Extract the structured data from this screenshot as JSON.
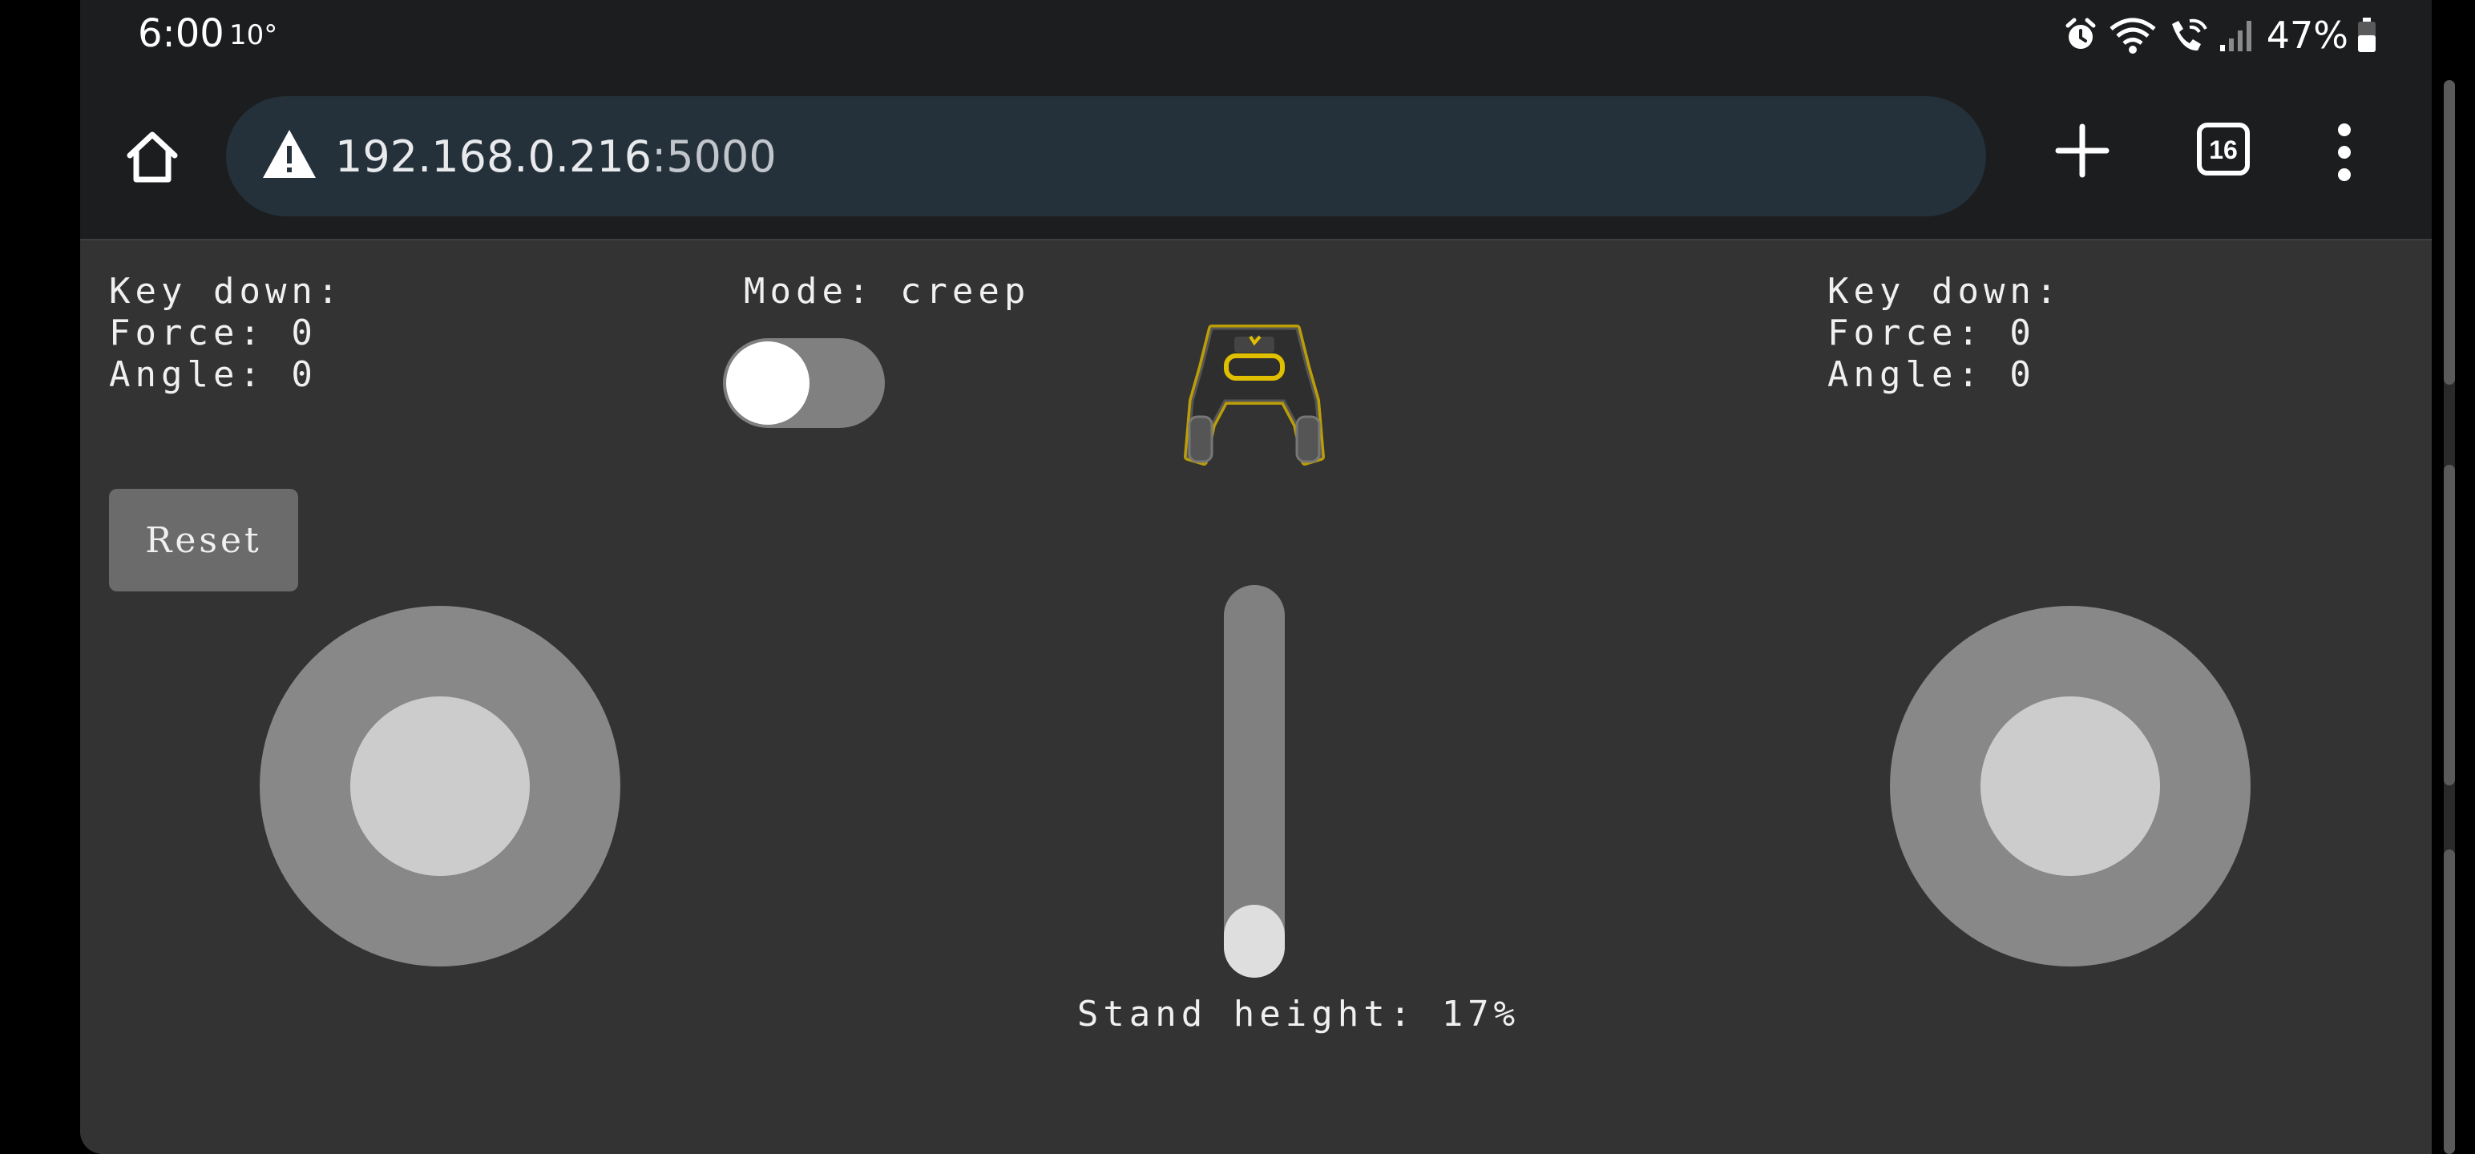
{
  "status_bar": {
    "time": "6:00",
    "temperature": "10°",
    "battery_percent": "47%",
    "icons": [
      "alarm-icon",
      "wifi-icon",
      "wifi-calling-icon",
      "signal-icon",
      "battery-icon"
    ]
  },
  "browser": {
    "url_host": "192.168.0.216",
    "url_port": ":5000",
    "tab_count": "16",
    "icons": [
      "home-icon",
      "not-secure-warning-icon",
      "new-tab-plus-icon",
      "tab-switcher-icon",
      "more-menu-icon"
    ]
  },
  "app": {
    "left_panel": {
      "key_down": "Key down:",
      "force": "Force: 0",
      "angle": "Angle: 0"
    },
    "right_panel": {
      "key_down": "Key down:",
      "force": "Force: 0",
      "angle": "Angle: 0"
    },
    "mode_label": "Mode: creep",
    "mode_toggle_on": false,
    "reset_label": "Reset",
    "stand_height_label": "Stand height: 17%",
    "stand_height_value": 0.17
  },
  "colors": {
    "page_background": "#333333",
    "joystick_base": "#888888",
    "joystick_knob": "#cccccc",
    "robot_glow": "#d4b200"
  }
}
